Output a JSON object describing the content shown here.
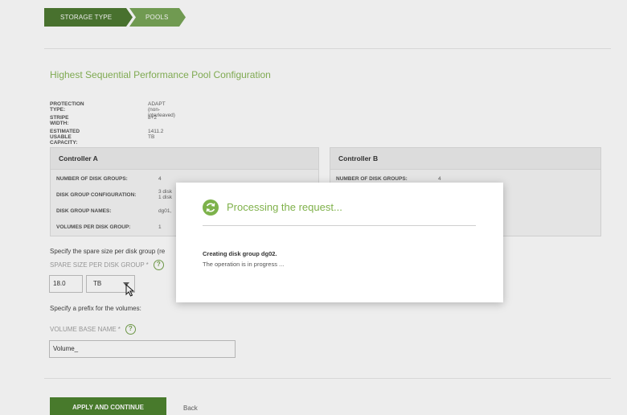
{
  "wizard": {
    "steps": [
      {
        "label": "STORAGE TYPE"
      },
      {
        "label": "POOLS"
      }
    ]
  },
  "page_title": "Highest Sequential Performance Pool Configuration",
  "summary": {
    "protection_type": {
      "label": "PROTECTION TYPE:",
      "value": "ADAPT (non-interleaved)"
    },
    "stripe_width": {
      "label": "STRIPE WIDTH:",
      "value": "8+2"
    },
    "estimated_capacity": {
      "label": "ESTIMATED USABLE CAPACITY:",
      "value": "1411.2 TB"
    }
  },
  "controller_a": {
    "title": "Controller A",
    "rows": [
      {
        "label": "NUMBER OF DISK GROUPS:",
        "value": "4"
      },
      {
        "label": "DISK GROUP CONFIGURATION:",
        "value": "3 disk\n1 disk"
      },
      {
        "label": "DISK GROUP NAMES:",
        "value": "dg01,"
      },
      {
        "label": "VOLUMES PER DISK GROUP:",
        "value": "1"
      }
    ]
  },
  "controller_b": {
    "title": "Controller B",
    "rows": [
      {
        "label": "NUMBER OF DISK GROUPS:",
        "value": "4"
      }
    ]
  },
  "spare": {
    "hint": "Specify the spare size per disk group (re",
    "label": "SPARE SIZE PER DISK GROUP",
    "required_mark": "*",
    "help": "?",
    "value": "18.0",
    "unit": "TB"
  },
  "volumes": {
    "hint": "Specify a prefix for the volumes:",
    "label": "VOLUME BASE NAME",
    "required_mark": "*",
    "help": "?",
    "value": "Volume_"
  },
  "actions": {
    "apply_label": "APPLY AND CONTINUE",
    "back_label": "Back"
  },
  "modal": {
    "title": "Processing the request...",
    "status": "Creating disk group dg02.",
    "detail": "The operation is in progress ...",
    "icon": "refresh-icon"
  },
  "colors": {
    "accent_green": "#7fb14a",
    "dark_green": "#3f6f21",
    "button_green": "#3f7a1f"
  }
}
